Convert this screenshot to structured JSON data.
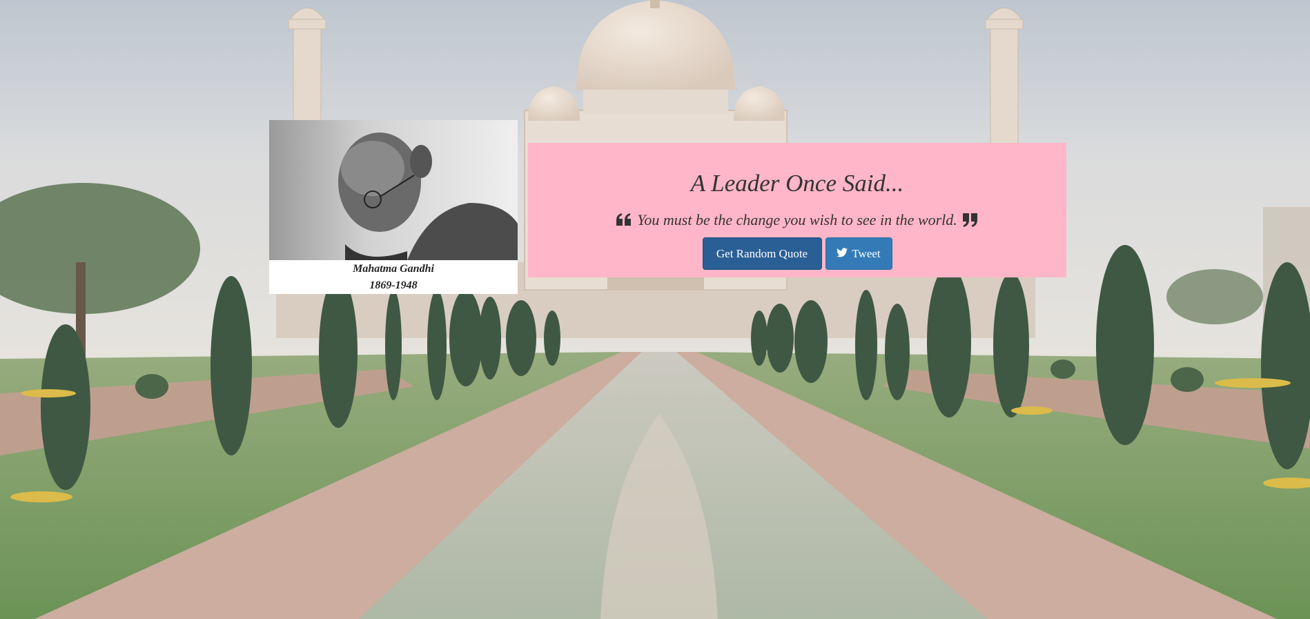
{
  "heading": "A Leader Once Said...",
  "quote": {
    "text": "You must be the change you wish to see in the world.",
    "open_icon": "quote-left-icon",
    "close_icon": "quote-right-icon"
  },
  "author": {
    "name": "Mahatma Gandhi",
    "years": "1869-1948"
  },
  "buttons": {
    "random_quote_label": "Get Random Quote",
    "tweet_label": "Tweet",
    "tweet_icon": "twitter-icon"
  },
  "colors": {
    "quote_box_bg": "#ffb6c8",
    "primary_button": "#2a5f96",
    "tweet_button": "#337ab7"
  }
}
